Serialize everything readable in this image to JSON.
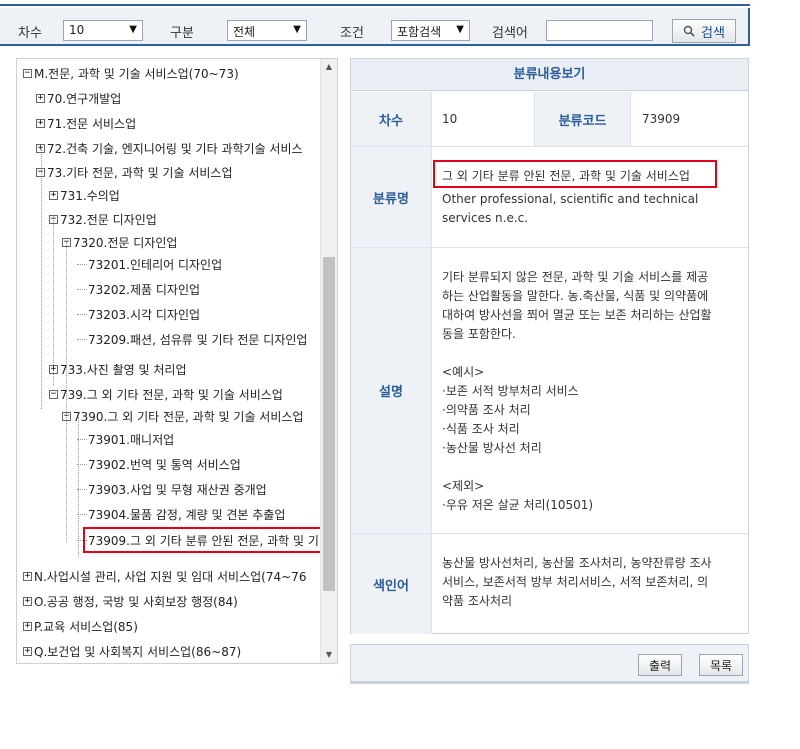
{
  "search": {
    "round_label": "차수",
    "round_value": "10",
    "category_label": "구분",
    "category_value": "전체",
    "condition_label": "조건",
    "condition_value": "포함검색",
    "keyword_label": "검색어",
    "keyword_value": "",
    "search_button": "검색"
  },
  "tree": {
    "nodes": [
      {
        "label": "M.전문, 과학 및 기술 서비스업(70~73)",
        "toggle": "−"
      },
      {
        "label": "70.연구개발업",
        "toggle": "+"
      },
      {
        "label": "71.전문 서비스업",
        "toggle": "+"
      },
      {
        "label": "72.건축 기술, 엔지니어링 및 기타 과학기술 서비스",
        "toggle": "+"
      },
      {
        "label": "73.기타 전문, 과학 및 기술 서비스업",
        "toggle": "−"
      },
      {
        "label": "731.수의업",
        "toggle": "+"
      },
      {
        "label": "732.전문 디자인업",
        "toggle": "−"
      },
      {
        "label": "7320.전문 디자인업",
        "toggle": "−"
      },
      {
        "label": "73201.인테리어 디자인업",
        "toggle": ""
      },
      {
        "label": "73202.제품 디자인업",
        "toggle": ""
      },
      {
        "label": "73203.시각 디자인업",
        "toggle": ""
      },
      {
        "label": "73209.패션, 섬유류 및 기타 전문 디자인업",
        "toggle": ""
      },
      {
        "label": "733.사진 촬영 및 처리업",
        "toggle": "+"
      },
      {
        "label": "739.그 외 기타 전문, 과학 및 기술 서비스업",
        "toggle": "−"
      },
      {
        "label": "7390.그 외 기타 전문, 과학 및 기술 서비스업",
        "toggle": "−"
      },
      {
        "label": "73901.매니저업",
        "toggle": ""
      },
      {
        "label": "73902.번역 및 통역 서비스업",
        "toggle": ""
      },
      {
        "label": "73903.사업 및 무형 재산권 중개업",
        "toggle": ""
      },
      {
        "label": "73904.물품 감정, 계량 및 견본 추출업",
        "toggle": ""
      },
      {
        "label": "73909.그 외 기타 분류 안된 전문, 과학 및 기",
        "toggle": ""
      },
      {
        "label": "N.사업시설 관리, 사업 지원 및 임대 서비스업(74~76",
        "toggle": "+"
      },
      {
        "label": "O.공공 행정, 국방 및 사회보장 행정(84)",
        "toggle": "+"
      },
      {
        "label": "P.교육 서비스업(85)",
        "toggle": "+"
      },
      {
        "label": "Q.보건업 및 사회복지 서비스업(86~87)",
        "toggle": "+"
      }
    ]
  },
  "detail": {
    "title": "분류내용보기",
    "round_label": "차수",
    "round_value": "10",
    "code_label": "분류코드",
    "code_value": "73909",
    "name_label": "분류명",
    "name_ko": "그 외 기타 분류 안된 전문, 과학 및 기술 서비스업",
    "name_en": "Other professional, scientific and technical services n.e.c.",
    "desc_label": "설명",
    "desc_lines": [
      "기타 분류되지 않은 전문, 과학 및 기술 서비스를 제공",
      "하는 산업활동을 말한다. 농.축산물, 식품 및 의약품에",
      "대하여 방사선을 쬐어 멸균 또는 보존 처리하는 산업활",
      "동을 포함한다.",
      "",
      "<예시>",
      "·보존 서적 방부처리 서비스",
      "·의약품 조사 처리",
      "·식품 조사 처리",
      "·농산물 방사선 처리",
      "",
      "<제외>",
      "·우유 저온 살균 처리(10501)"
    ],
    "index_label": "색인어",
    "index_lines": [
      "농산물 방사선처리, 농산물 조사처리, 농약잔류량 조사",
      "서비스, 보존서적 방부 처리서비스, 서적 보존처리, 의",
      "약품 조사처리"
    ]
  },
  "footer": {
    "print_button": "출력",
    "list_button": "목록"
  }
}
